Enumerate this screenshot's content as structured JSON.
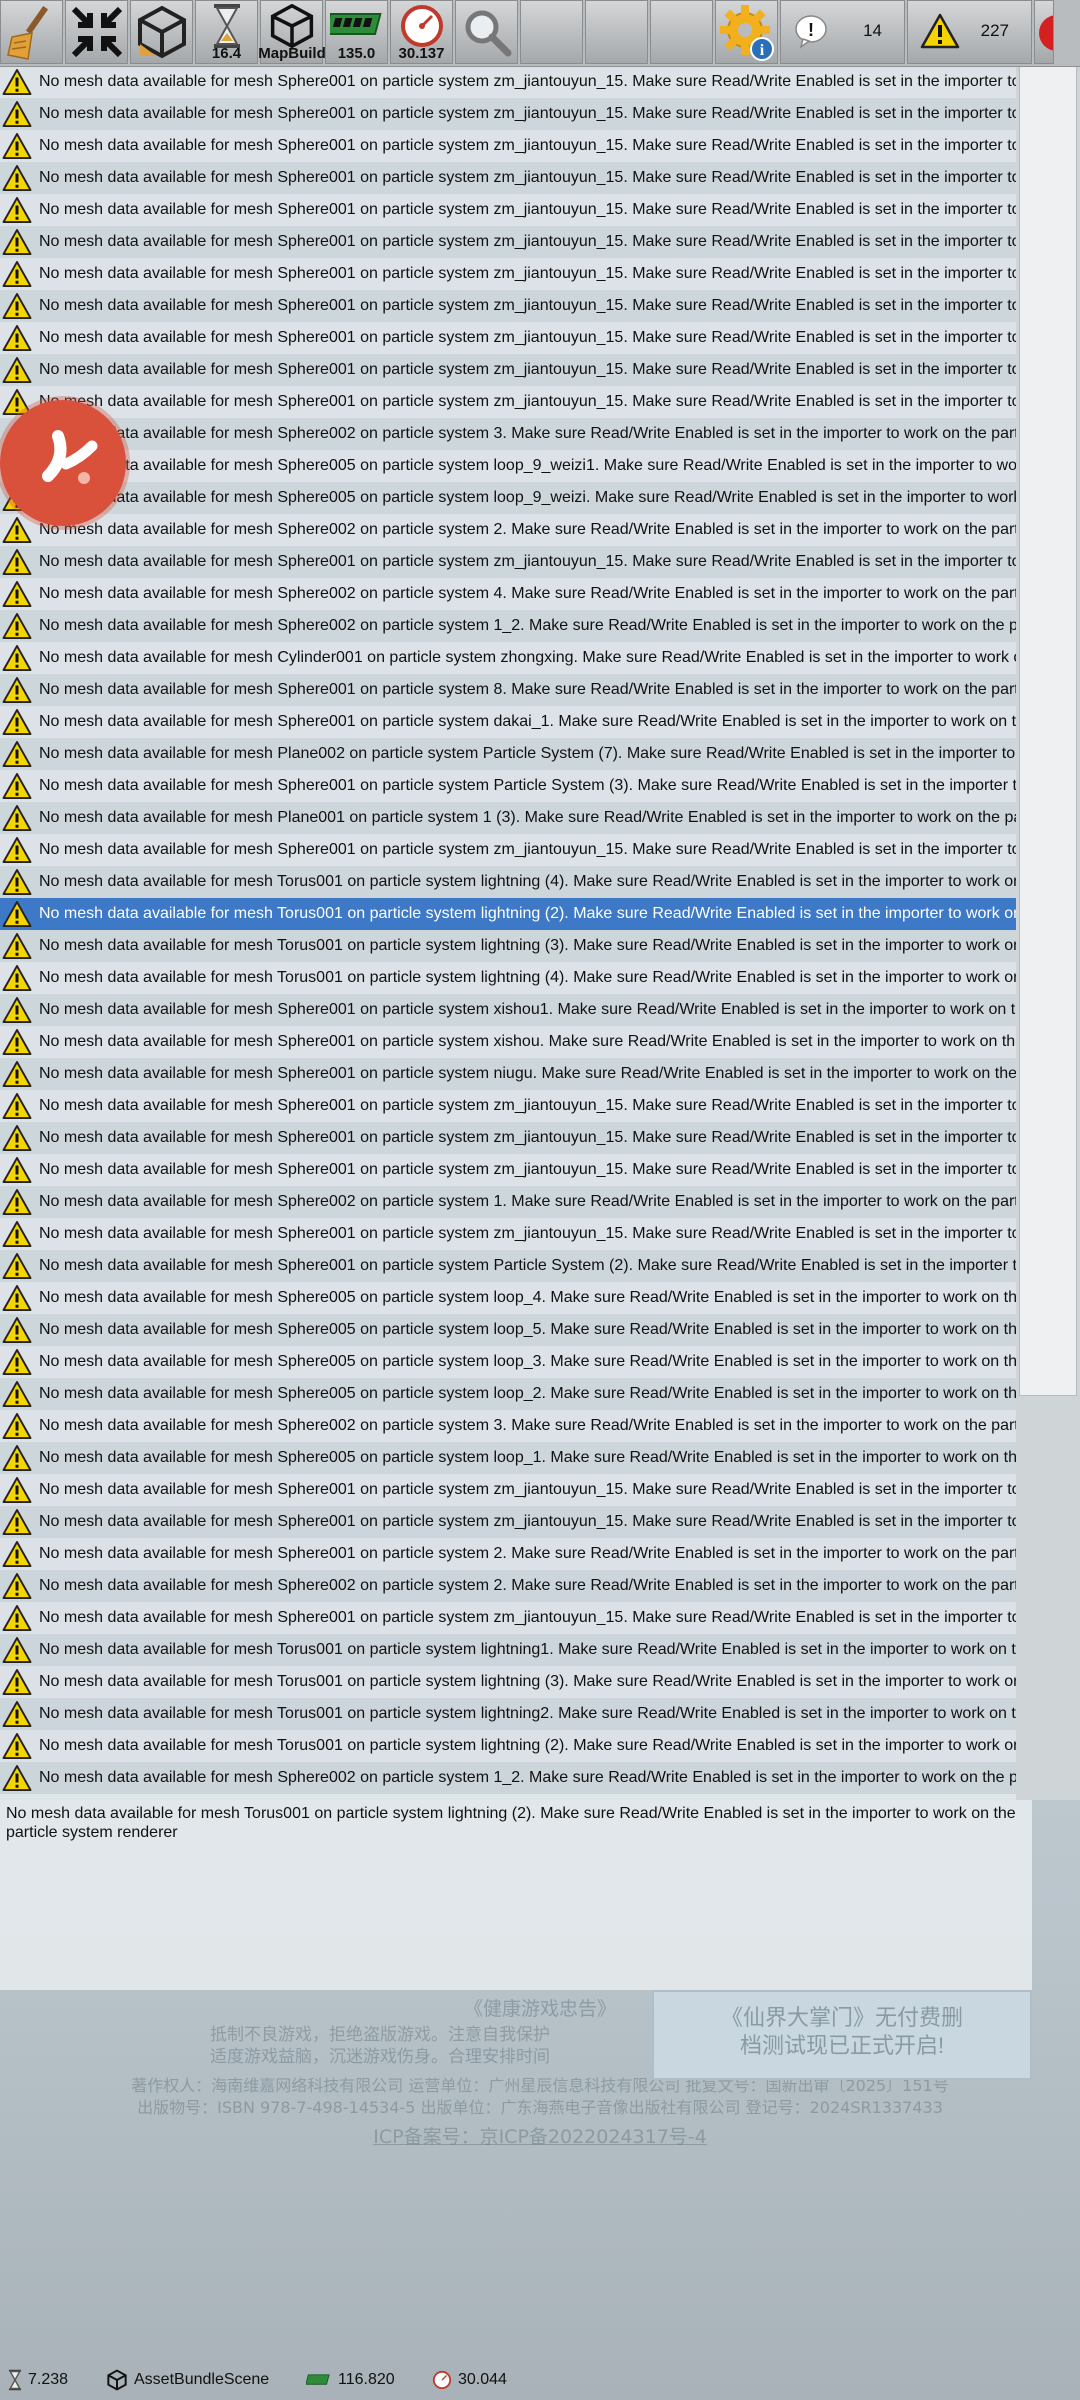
{
  "toolbar": {
    "buttons": [
      {
        "name": "broom-icon",
        "value": ""
      },
      {
        "name": "shrink-arrows-icon",
        "value": ""
      },
      {
        "name": "unity-logo-icon",
        "value": ""
      },
      {
        "name": "hourglass-icon",
        "value": "16.4"
      },
      {
        "name": "unity-scene-icon",
        "value": "MapBuild"
      },
      {
        "name": "memory-chip-icon",
        "value": "135.0"
      },
      {
        "name": "speedometer-icon",
        "value": "30.137"
      },
      {
        "name": "magnifier-icon",
        "value": ""
      }
    ],
    "info_count": "14",
    "warning_count": "227"
  },
  "log": {
    "rows": [
      "No mesh data available for mesh Sphere001 on particle system zm_jiantouyun_15. Make sure Read/Write Enabled is set in the importer to",
      "No mesh data available for mesh Sphere001 on particle system zm_jiantouyun_15. Make sure Read/Write Enabled is set in the importer to",
      "No mesh data available for mesh Sphere001 on particle system zm_jiantouyun_15. Make sure Read/Write Enabled is set in the importer to",
      "No mesh data available for mesh Sphere001 on particle system zm_jiantouyun_15. Make sure Read/Write Enabled is set in the importer to",
      "No mesh data available for mesh Sphere001 on particle system zm_jiantouyun_15. Make sure Read/Write Enabled is set in the importer to",
      "No mesh data available for mesh Sphere001 on particle system zm_jiantouyun_15. Make sure Read/Write Enabled is set in the importer to",
      "No mesh data available for mesh Sphere001 on particle system zm_jiantouyun_15. Make sure Read/Write Enabled is set in the importer to",
      "No mesh data available for mesh Sphere001 on particle system zm_jiantouyun_15. Make sure Read/Write Enabled is set in the importer to",
      "No mesh data available for mesh Sphere001 on particle system zm_jiantouyun_15. Make sure Read/Write Enabled is set in the importer to",
      "No mesh data available for mesh Sphere001 on particle system zm_jiantouyun_15. Make sure Read/Write Enabled is set in the importer to",
      "No mesh data available for mesh Sphere001 on particle system zm_jiantouyun_15. Make sure Read/Write Enabled is set in the importer to",
      "No mesh data available for mesh Sphere002 on particle system 3. Make sure Read/Write Enabled is set in the importer to work on the partic",
      "No mesh data available for mesh Sphere005 on particle system loop_9_weizi1. Make sure Read/Write Enabled is set in the importer to wor",
      "No mesh data available for mesh Sphere005 on particle system loop_9_weizi. Make sure Read/Write Enabled is set in the importer to work",
      "No mesh data available for mesh Sphere002 on particle system 2. Make sure Read/Write Enabled is set in the importer to work on the partic",
      "No mesh data available for mesh Sphere001 on particle system zm_jiantouyun_15. Make sure Read/Write Enabled is set in the importer to",
      "No mesh data available for mesh Sphere002 on particle system 4. Make sure Read/Write Enabled is set in the importer to work on the partic",
      "No mesh data available for mesh Sphere002 on particle system 1_2. Make sure Read/Write Enabled is set in the importer to work on the pa",
      "No mesh data available for mesh Cylinder001 on particle system zhongxing. Make sure Read/Write Enabled is set in the importer to work o",
      "No mesh data available for mesh Sphere001 on particle system 8. Make sure Read/Write Enabled is set in the importer to work on the partic",
      "No mesh data available for mesh Sphere001 on particle system dakai_1. Make sure Read/Write Enabled is set in the importer to work on th",
      "No mesh data available for mesh Plane002 on particle system Particle System (7). Make sure Read/Write Enabled is set in the importer to w",
      "No mesh data available for mesh Sphere001 on particle system Particle System (3). Make sure Read/Write Enabled is set in the importer to",
      "No mesh data available for mesh Plane001 on particle system 1 (3). Make sure Read/Write Enabled is set in the importer to work on the par",
      "No mesh data available for mesh Sphere001 on particle system zm_jiantouyun_15. Make sure Read/Write Enabled is set in the importer to",
      "No mesh data available for mesh Torus001 on particle system lightning (4). Make sure Read/Write Enabled is set in the importer to work or",
      "No mesh data available for mesh Torus001 on particle system lightning (2). Make sure Read/Write Enabled is set in the importer to work on",
      "No mesh data available for mesh Torus001 on particle system lightning (3). Make sure Read/Write Enabled is set in the importer to work or",
      "No mesh data available for mesh Torus001 on particle system lightning (4). Make sure Read/Write Enabled is set in the importer to work or",
      "No mesh data available for mesh Sphere001 on particle system xishou1. Make sure Read/Write Enabled is set in the importer to work on th",
      "No mesh data available for mesh Sphere001 on particle system xishou. Make sure Read/Write Enabled is set in the importer to work on the",
      "No mesh data available for mesh Sphere001 on particle system niugu. Make sure Read/Write Enabled is set in the importer to work on the p",
      "No mesh data available for mesh Sphere001 on particle system zm_jiantouyun_15. Make sure Read/Write Enabled is set in the importer to",
      "No mesh data available for mesh Sphere001 on particle system zm_jiantouyun_15. Make sure Read/Write Enabled is set in the importer to",
      "No mesh data available for mesh Sphere001 on particle system zm_jiantouyun_15. Make sure Read/Write Enabled is set in the importer to",
      "No mesh data available for mesh Sphere002 on particle system 1. Make sure Read/Write Enabled is set in the importer to work on the partic",
      "No mesh data available for mesh Sphere001 on particle system zm_jiantouyun_15. Make sure Read/Write Enabled is set in the importer to",
      "No mesh data available for mesh Sphere001 on particle system Particle System (2). Make sure Read/Write Enabled is set in the importer to",
      "No mesh data available for mesh Sphere005 on particle system loop_4. Make sure Read/Write Enabled is set in the importer to work on the",
      "No mesh data available for mesh Sphere005 on particle system loop_5. Make sure Read/Write Enabled is set in the importer to work on the",
      "No mesh data available for mesh Sphere005 on particle system loop_3. Make sure Read/Write Enabled is set in the importer to work on the",
      "No mesh data available for mesh Sphere005 on particle system loop_2. Make sure Read/Write Enabled is set in the importer to work on the",
      "No mesh data available for mesh Sphere002 on particle system 3. Make sure Read/Write Enabled is set in the importer to work on the partic",
      "No mesh data available for mesh Sphere005 on particle system loop_1. Make sure Read/Write Enabled is set in the importer to work on the",
      "No mesh data available for mesh Sphere001 on particle system zm_jiantouyun_15. Make sure Read/Write Enabled is set in the importer to",
      "No mesh data available for mesh Sphere001 on particle system zm_jiantouyun_15. Make sure Read/Write Enabled is set in the importer to",
      "No mesh data available for mesh Sphere001 on particle system 2. Make sure Read/Write Enabled is set in the importer to work on the partic",
      "No mesh data available for mesh Sphere002 on particle system 2. Make sure Read/Write Enabled is set in the importer to work on the partic",
      "No mesh data available for mesh Sphere001 on particle system zm_jiantouyun_15. Make sure Read/Write Enabled is set in the importer to",
      "No mesh data available for mesh Torus001 on particle system lightning1. Make sure Read/Write Enabled is set in the importer to work on th",
      "No mesh data available for mesh Torus001 on particle system lightning (3). Make sure Read/Write Enabled is set in the importer to work or",
      "No mesh data available for mesh Torus001 on particle system lightning2. Make sure Read/Write Enabled is set in the importer to work on th",
      "No mesh data available for mesh Torus001 on particle system lightning (2). Make sure Read/Write Enabled is set in the importer to work or",
      "No mesh data available for mesh Sphere002 on particle system 1_2. Make sure Read/Write Enabled is set in the importer to work on the pa"
    ],
    "selected_index": 26,
    "detail": "No mesh data available for mesh Torus001 on particle system lightning (2). Make sure Read/Write Enabled is set in the importer to work on the particle system renderer"
  },
  "background": {
    "notice_title": "《健康游戏忠告》",
    "notice_line1": "抵制不良游戏，拒绝盗版游戏。注意自我保护",
    "notice_line2": "适度游戏益脑，沉迷游戏伤身。合理安排时间",
    "publisher_line": "著作权人：海南维嘉网络科技有限公司 运营单位：广州星辰信息科技有限公司 批复文号：国新出审〔2025〕151号",
    "isbn_line": "出版物号：ISBN 978-7-498-14534-5 出版单位：广东海燕电子音像出版社有限公司 登记号：2024SR1337433",
    "icp_line": "ICP备案号：京ICP备2022024317号-4",
    "banner_line1": "《仙界大掌门》无付费删",
    "banner_line2": "档测试现已正式开启!"
  },
  "statusbar": {
    "time": "7.238",
    "scene": "AssetBundleScene",
    "memory": "116.820",
    "fps": "30.044"
  },
  "colors": {
    "selected_row": "#3d79c6",
    "fab": "#d9503b",
    "warning_yellow": "#f5d400"
  }
}
